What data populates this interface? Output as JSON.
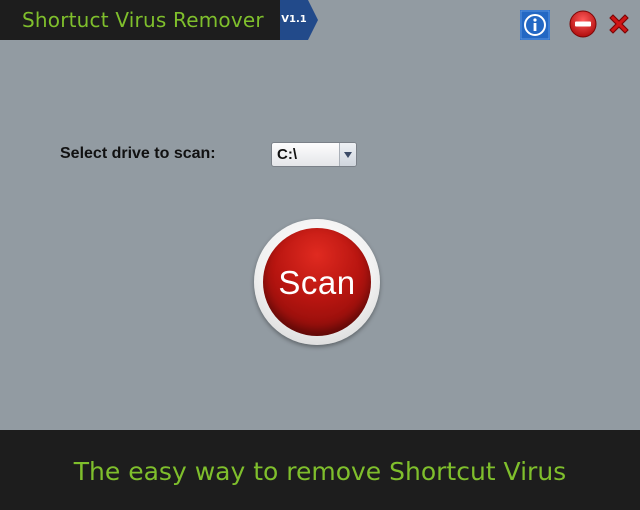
{
  "app": {
    "title": "Shortuct Virus Remover",
    "version": "V1.1"
  },
  "window_controls": {
    "info_icon": "info-icon",
    "minimize_icon": "minus-circle-icon",
    "close_icon": "close-x-icon"
  },
  "drive": {
    "label": "Select drive to scan:",
    "selected": "C:\\"
  },
  "scan": {
    "label": "Scan"
  },
  "footer": {
    "tagline": "The easy way to remove Shortcut Virus"
  },
  "colors": {
    "background": "#929ba2",
    "bar": "#1d1d1d",
    "accent_green": "#7fbf2c",
    "version_blue": "#224a8a",
    "scan_red": "#b81510"
  }
}
